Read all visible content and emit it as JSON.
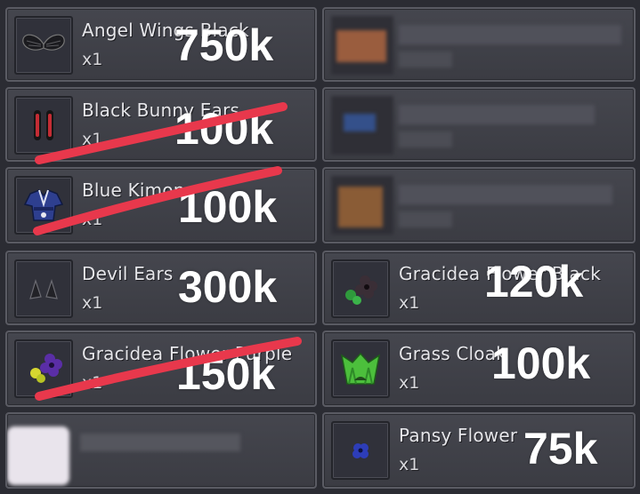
{
  "items": [
    {
      "name": "Angel Wings Black",
      "qty": "x1",
      "price": "750k",
      "icon": "angel-wings-black-icon",
      "crossed": false
    },
    {
      "name": "Black Bunny Ears",
      "qty": "x1",
      "price": "100k",
      "icon": "black-bunny-ears-icon",
      "crossed": true
    },
    {
      "name": "Blue Kimono",
      "qty": "x1",
      "price": "100k",
      "icon": "blue-kimono-icon",
      "crossed": true
    },
    {
      "name": "Devil Ears",
      "qty": "x1",
      "price": "300k",
      "icon": "devil-ears-icon",
      "crossed": false
    },
    {
      "name": "Gracidea Flower Purple",
      "qty": "x1",
      "price": "150k",
      "icon": "gracidea-flower-purple-icon",
      "crossed": true
    },
    {
      "name": "Gracidea Flower Black",
      "qty": "x1",
      "price": "120k",
      "icon": "gracidea-flower-black-icon",
      "crossed": false
    },
    {
      "name": "Grass Cloak",
      "qty": "x1",
      "price": "100k",
      "icon": "grass-cloak-icon",
      "crossed": false
    },
    {
      "name": "Pansy Flower",
      "qty": "x1",
      "price": "75k",
      "icon": "pansy-flower-icon",
      "crossed": false
    }
  ],
  "colors": {
    "strike": "#e8384c",
    "price": "#ffffff",
    "panel": "#3f4047",
    "background": "#2b2c33"
  }
}
